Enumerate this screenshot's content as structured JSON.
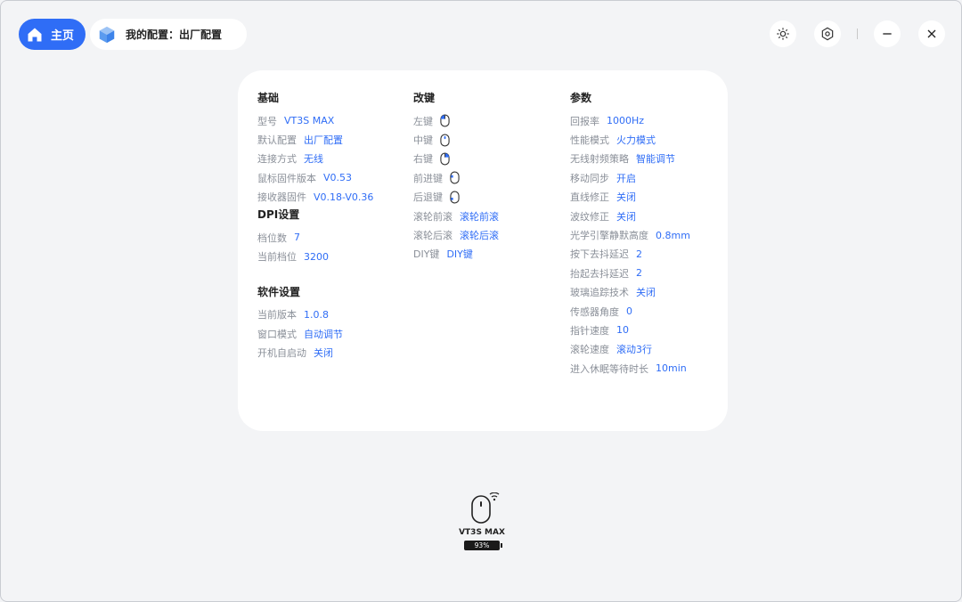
{
  "topbar": {
    "home_label": "主页",
    "config_label": "我的配置：出厂配置"
  },
  "basic": {
    "title": "基础",
    "rows": [
      {
        "k": "型号",
        "v": "VT3S MAX"
      },
      {
        "k": "默认配置",
        "v": "出厂配置"
      },
      {
        "k": "连接方式",
        "v": "无线"
      },
      {
        "k": "鼠标固件版本",
        "v": "V0.53"
      },
      {
        "k": "接收器固件",
        "v": "V0.18-V0.36"
      }
    ]
  },
  "dpi": {
    "title": "DPI设置",
    "rows": [
      {
        "k": "档位数",
        "v": "7"
      },
      {
        "k": "当前档位",
        "v": "3200"
      }
    ]
  },
  "software": {
    "title": "软件设置",
    "rows": [
      {
        "k": "当前版本",
        "v": "1.0.8"
      },
      {
        "k": "窗口模式",
        "v": "自动调节"
      },
      {
        "k": "开机自启动",
        "v": "关闭"
      }
    ]
  },
  "keys": {
    "title": "改键",
    "rows": [
      {
        "k": "左键",
        "icon": "mouse-left-icon"
      },
      {
        "k": "中键",
        "icon": "mouse-middle-icon"
      },
      {
        "k": "右键",
        "icon": "mouse-right-icon"
      },
      {
        "k": "前进键",
        "icon": "mouse-forward-icon"
      },
      {
        "k": "后退键",
        "icon": "mouse-back-icon"
      },
      {
        "k": "滚轮前滚",
        "v": "滚轮前滚"
      },
      {
        "k": "滚轮后滚",
        "v": "滚轮后滚"
      },
      {
        "k": "DIY键",
        "v": "DIY键"
      }
    ]
  },
  "params": {
    "title": "参数",
    "rows": [
      {
        "k": "回报率",
        "v": "1000Hz"
      },
      {
        "k": "性能模式",
        "v": "火力模式"
      },
      {
        "k": "无线射频策略",
        "v": "智能调节"
      },
      {
        "k": "移动同步",
        "v": "开启"
      },
      {
        "k": "直线修正",
        "v": "关闭"
      },
      {
        "k": "波纹修正",
        "v": "关闭"
      },
      {
        "k": "光学引擎静默高度",
        "v": "0.8mm"
      },
      {
        "k": "按下去抖延迟",
        "v": "2"
      },
      {
        "k": "抬起去抖延迟",
        "v": "2"
      },
      {
        "k": "玻璃追踪技术",
        "v": "关闭"
      },
      {
        "k": "传感器角度",
        "v": "0"
      },
      {
        "k": "指针速度",
        "v": "10"
      },
      {
        "k": "滚轮速度",
        "v": "滚动3行"
      },
      {
        "k": "进入休眠等待时长",
        "v": "10min"
      }
    ]
  },
  "device": {
    "name": "VT3S MAX",
    "battery": "93%"
  },
  "colors": {
    "accent": "#2f6df6",
    "label": "#8a8f98"
  }
}
